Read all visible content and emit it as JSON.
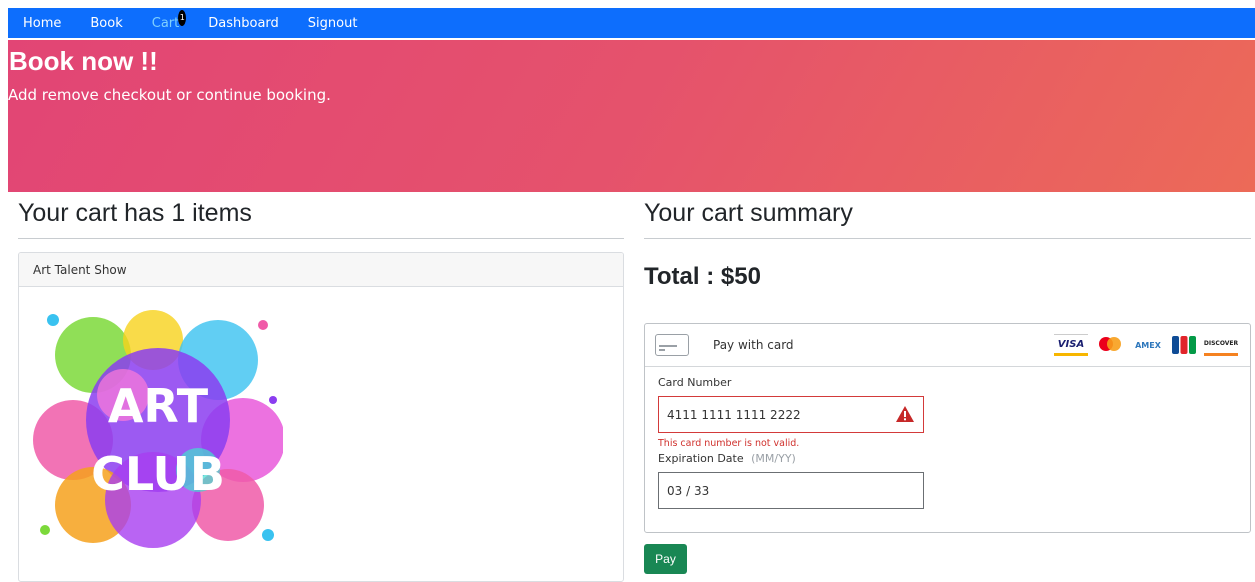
{
  "nav": {
    "items": [
      {
        "label": "Home"
      },
      {
        "label": "Book"
      },
      {
        "label": "Cart",
        "badge": "1"
      },
      {
        "label": "Dashboard"
      },
      {
        "label": "Signout"
      }
    ]
  },
  "hero": {
    "title": "Book now !!",
    "subtitle": "Add remove checkout or continue booking."
  },
  "cart": {
    "heading": "Your cart has 1 items",
    "item_title": "Art Talent Show",
    "item_image_text_line1": "ART",
    "item_image_text_line2": "CLUB"
  },
  "summary": {
    "heading": "Your cart summary",
    "total": "Total : $50"
  },
  "payment": {
    "pay_with": "Pay with card",
    "brands": [
      "VISA",
      "mastercard",
      "AMEX",
      "JCB",
      "DISCOVER"
    ],
    "card_number_label": "Card Number",
    "card_number_value": "4111 1111 1111 2222",
    "card_number_error": "This card number is not valid.",
    "expiration_label": "Expiration Date",
    "expiration_hint": "(MM/YY)",
    "expiration_value": "03 / 33",
    "pay_button": "Pay"
  },
  "colors": {
    "navbar": "#0d6efd",
    "hero_start": "#e24575",
    "hero_end": "#ec6a58",
    "error": "#d0312d",
    "pay_button": "#198754"
  }
}
